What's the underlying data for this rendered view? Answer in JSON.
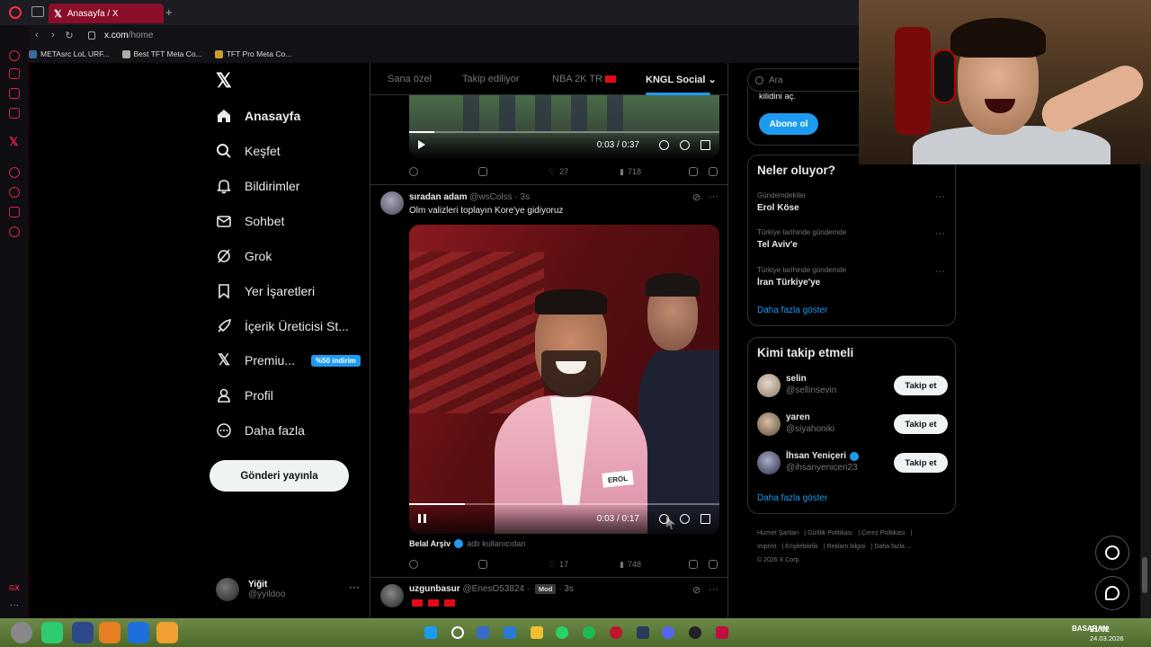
{
  "browser": {
    "tab_title": "Anasayfa / X",
    "url_host": "x.com",
    "url_path": "/home",
    "bookmarks": [
      "METAsrc LoL URF...",
      "Best TFT Meta Co...",
      "TFT Pro Meta Co..."
    ]
  },
  "nav": {
    "items": [
      {
        "label": "Anasayfa",
        "icon": "home-icon"
      },
      {
        "label": "Keşfet",
        "icon": "search-icon"
      },
      {
        "label": "Bildirimler",
        "icon": "bell-icon"
      },
      {
        "label": "Sohbet",
        "icon": "envelope-icon"
      },
      {
        "label": "Grok",
        "icon": "grok-icon"
      },
      {
        "label": "Yer İşaretleri",
        "icon": "bookmark-icon"
      },
      {
        "label": "İçerik Üreticisi St...",
        "icon": "rocket-icon"
      },
      {
        "label": "Premiu...",
        "icon": "x-logo-icon"
      },
      {
        "label": "Profil",
        "icon": "person-icon"
      },
      {
        "label": "Daha fazla",
        "icon": "more-circle-icon"
      }
    ],
    "premium_badge": "%50 indirim",
    "post_button": "Gönderi yayınla"
  },
  "profile": {
    "name": "Yiğit",
    "handle": "@yyildoo"
  },
  "feed_tabs": [
    "Sana özel",
    "Takip ediliyor",
    "NBA 2K TR",
    "KNGL Social"
  ],
  "feed": {
    "prev_video": {
      "time": "0:03 / 0:37",
      "replies": "",
      "reposts": "",
      "likes": "27",
      "views": "718",
      "progress": 0.08
    },
    "tweet": {
      "name": "sıradan adam",
      "handle": "@wsColss",
      "age": "3s",
      "text": "Olm valizleri toplayın Kore'ye gidiyoruz",
      "video_tag": "EROL",
      "video_time": "0:03 / 0:17",
      "video_progress": 0.18,
      "source_name": "Belal Arşiv",
      "source_suffix": "adlı kullanıcıdan",
      "likes": "17",
      "views": "748"
    },
    "next_tweet": {
      "name": "uzgunbasur",
      "handle": "@EnesO53824",
      "badge": "Mod",
      "age": "3s"
    }
  },
  "right": {
    "search_placeholder": "Ara",
    "premium_text": "kilidini aç.",
    "subscribe": "Abone ol",
    "trends_title": "Neler oluyor?",
    "trends": [
      {
        "meta": "Gündemdekiler",
        "name": "Erol Köse"
      },
      {
        "meta": "Türkiye tarihinde gündemde",
        "name": "Tel Aviv'e"
      },
      {
        "meta": "Türkiye tarihinde gündemde",
        "name": "İran Türkiye'ye"
      }
    ],
    "show_more": "Daha fazla göster",
    "follow_title": "Kimi takip etmeli",
    "follow": [
      {
        "name": "selin",
        "handle": "@sellinsevin",
        "verified": false
      },
      {
        "name": "yaren",
        "handle": "@siyahoniki",
        "verified": false
      },
      {
        "name": "İhsan Yeniçeri",
        "handle": "@ihsanyeniceri23",
        "verified": true
      }
    ],
    "follow_button": "Takip et",
    "footer": [
      "Hizmet Şartları",
      "Gizlilik Politikası",
      "Çerez Politikası",
      "Imprint",
      "Erişilebilirlik",
      "Reklam bilgisi",
      "Daha fazla ...",
      "© 2026 X Corp."
    ]
  },
  "taskbar": {
    "tray_label": "BASARAN",
    "time": "21:02",
    "date": "24.03.2026"
  },
  "colors": {
    "accent": "#1d9bf0",
    "opera": "#ff2b4a",
    "bg": "#000000"
  }
}
